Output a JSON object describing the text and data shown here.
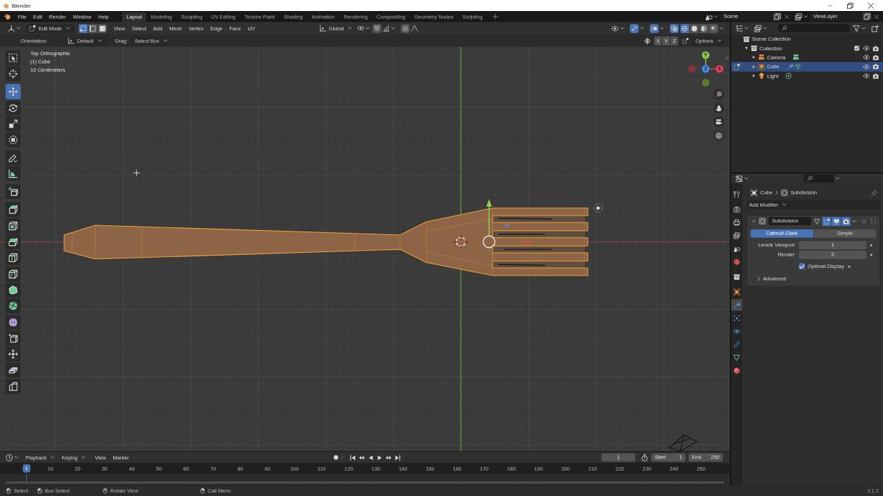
{
  "window": {
    "title": "Blender"
  },
  "menu_bar": {
    "menus": [
      "File",
      "Edit",
      "Render",
      "Window",
      "Help"
    ],
    "workspaces": [
      {
        "label": "Layout",
        "selected": true
      },
      {
        "label": "Modeling",
        "selected": false
      },
      {
        "label": "Sculpting",
        "selected": false
      },
      {
        "label": "UV Editing",
        "selected": false
      },
      {
        "label": "Texture Paint",
        "selected": false
      },
      {
        "label": "Shading",
        "selected": false
      },
      {
        "label": "Animation",
        "selected": false
      },
      {
        "label": "Rendering",
        "selected": false
      },
      {
        "label": "Compositing",
        "selected": false
      },
      {
        "label": "Geometry Nodes",
        "selected": false
      },
      {
        "label": "Scripting",
        "selected": false
      }
    ],
    "scene": "Scene",
    "view_layer": "ViewLayer"
  },
  "viewport_header": {
    "mode": "Edit Mode",
    "select_modes": [
      {
        "kind": "vertex",
        "selected": true
      },
      {
        "kind": "edge",
        "selected": false
      },
      {
        "kind": "face",
        "selected": false
      }
    ],
    "menus": [
      "View",
      "Select",
      "Add",
      "Mesh",
      "Vertex",
      "Edge",
      "Face",
      "UV"
    ],
    "orientation": "Global",
    "snap": false,
    "proportional_editing": false,
    "gizmos": true,
    "overlays": true,
    "xray": true,
    "shading": [
      {
        "kind": "wireframe",
        "selected": true
      },
      {
        "kind": "solid",
        "selected": false
      },
      {
        "kind": "material",
        "selected": false
      },
      {
        "kind": "rendered",
        "selected": false
      }
    ]
  },
  "tool_settings": {
    "orientation_label": "Orientation:",
    "orientation": "Default",
    "drag_label": "Drag:",
    "drag": "Select Box",
    "mirror": [
      {
        "label": "X",
        "on": false
      },
      {
        "label": "Y",
        "on": false
      },
      {
        "label": "Z",
        "on": false
      }
    ],
    "options": "Options"
  },
  "viewport": {
    "info": [
      "Top Orthographic",
      "(1) Cube",
      "10 Centimeters"
    ],
    "tools": [
      [
        {
          "kind": "select",
          "selected": false
        },
        {
          "kind": "cursor",
          "selected": false
        }
      ],
      [
        {
          "kind": "move",
          "selected": true
        },
        {
          "kind": "rotate",
          "selected": false
        },
        {
          "kind": "scale",
          "selected": false
        },
        {
          "kind": "transform",
          "selected": false
        }
      ],
      [
        {
          "kind": "annotate",
          "selected": false
        },
        {
          "kind": "measure",
          "selected": false
        }
      ],
      [
        {
          "kind": "add",
          "selected": false
        }
      ],
      [
        {
          "kind": "extrude",
          "selected": false
        },
        {
          "kind": "inset",
          "selected": false
        },
        {
          "kind": "bevel",
          "selected": false
        },
        {
          "kind": "loopcut",
          "selected": false
        },
        {
          "kind": "knife",
          "selected": false
        },
        {
          "kind": "polybuild",
          "selected": false
        },
        {
          "kind": "spin",
          "selected": false
        },
        {
          "kind": "smooth",
          "selected": false
        },
        {
          "kind": "slide",
          "selected": false
        },
        {
          "kind": "shrink",
          "selected": false
        },
        {
          "kind": "shear",
          "selected": false
        },
        {
          "kind": "rip",
          "selected": false
        }
      ]
    ],
    "navigation_gizmo": [
      "Y",
      "Z",
      "X"
    ]
  },
  "outliner": {
    "tree": [
      {
        "label": "Scene Collection",
        "kind": "scene_collection",
        "selected": false,
        "children": [
          {
            "label": "Collection",
            "kind": "collection",
            "selected": false,
            "expanded": true,
            "checked": true,
            "visible": true,
            "renderable": true,
            "children": [
              {
                "label": "Camera",
                "kind": "camera",
                "selected": false,
                "expanded": false,
                "editing": false,
                "visible": true,
                "renderable": true
              },
              {
                "label": "Cube",
                "kind": "mesh",
                "selected": true,
                "expanded": false,
                "editing": true,
                "visible": true,
                "renderable": true
              },
              {
                "label": "Light",
                "kind": "light",
                "selected": false,
                "expanded": false,
                "editing": false,
                "visible": true,
                "renderable": true
              }
            ]
          }
        ]
      }
    ]
  },
  "properties": {
    "tabs": [
      [
        {
          "kind": "tool",
          "selected": false
        }
      ],
      [
        {
          "kind": "render",
          "selected": false
        },
        {
          "kind": "output",
          "selected": false
        },
        {
          "kind": "view_layer",
          "selected": false
        },
        {
          "kind": "scene",
          "selected": false
        },
        {
          "kind": "world",
          "selected": false
        }
      ],
      [
        {
          "kind": "collection",
          "selected": false
        }
      ],
      [
        {
          "kind": "object",
          "selected": false
        },
        {
          "kind": "modifiers",
          "selected": true
        },
        {
          "kind": "particles",
          "selected": false
        },
        {
          "kind": "physics",
          "selected": false
        },
        {
          "kind": "constraints",
          "selected": false
        },
        {
          "kind": "data",
          "selected": false
        },
        {
          "kind": "material",
          "selected": false
        }
      ]
    ],
    "breadcrumb": [
      "Cube",
      "Subdivision"
    ],
    "add_modifier": "Add Modifier",
    "modifier": {
      "name": "Subdivision",
      "expanded": true,
      "toggles": [
        {
          "kind": "on_cage",
          "on": false
        },
        {
          "kind": "edit_mode",
          "on": true
        },
        {
          "kind": "viewport",
          "on": true
        },
        {
          "kind": "render",
          "on": true
        }
      ],
      "methods": [
        {
          "label": "Catmull-Clark",
          "selected": true
        },
        {
          "label": "Simple",
          "selected": false
        }
      ],
      "fields": [
        {
          "label": "Levels Viewport",
          "value": "1"
        },
        {
          "label": "Render",
          "value": "2"
        }
      ],
      "optimal_display": {
        "label": "Optimal Display",
        "checked": true
      },
      "advanced": {
        "label": "Advanced",
        "expanded": false
      }
    }
  },
  "timeline": {
    "menus": [
      {
        "label": "Playback",
        "kind": "dropdown"
      },
      {
        "label": "Keying",
        "kind": "dropdown"
      },
      {
        "label": "View",
        "kind": "menu"
      },
      {
        "label": "Marker",
        "kind": "menu"
      }
    ],
    "current_frame": "1",
    "start_label": "Start",
    "start": "1",
    "end_label": "End",
    "end": "250",
    "ruler": [
      "10",
      "20",
      "30",
      "40",
      "50",
      "60",
      "70",
      "80",
      "90",
      "100",
      "110",
      "120",
      "130",
      "140",
      "150",
      "160",
      "170",
      "180",
      "190",
      "200",
      "210",
      "220",
      "230",
      "240",
      "250"
    ],
    "playhead": "1"
  },
  "status_bar": {
    "hints": [
      {
        "label": "Select",
        "kind": "left"
      },
      {
        "label": "Box Select",
        "kind": "drag"
      },
      {
        "label": "Rotate View",
        "kind": "middle"
      },
      {
        "label": "Call Menu",
        "kind": "right"
      }
    ],
    "version": "3.1.2"
  }
}
